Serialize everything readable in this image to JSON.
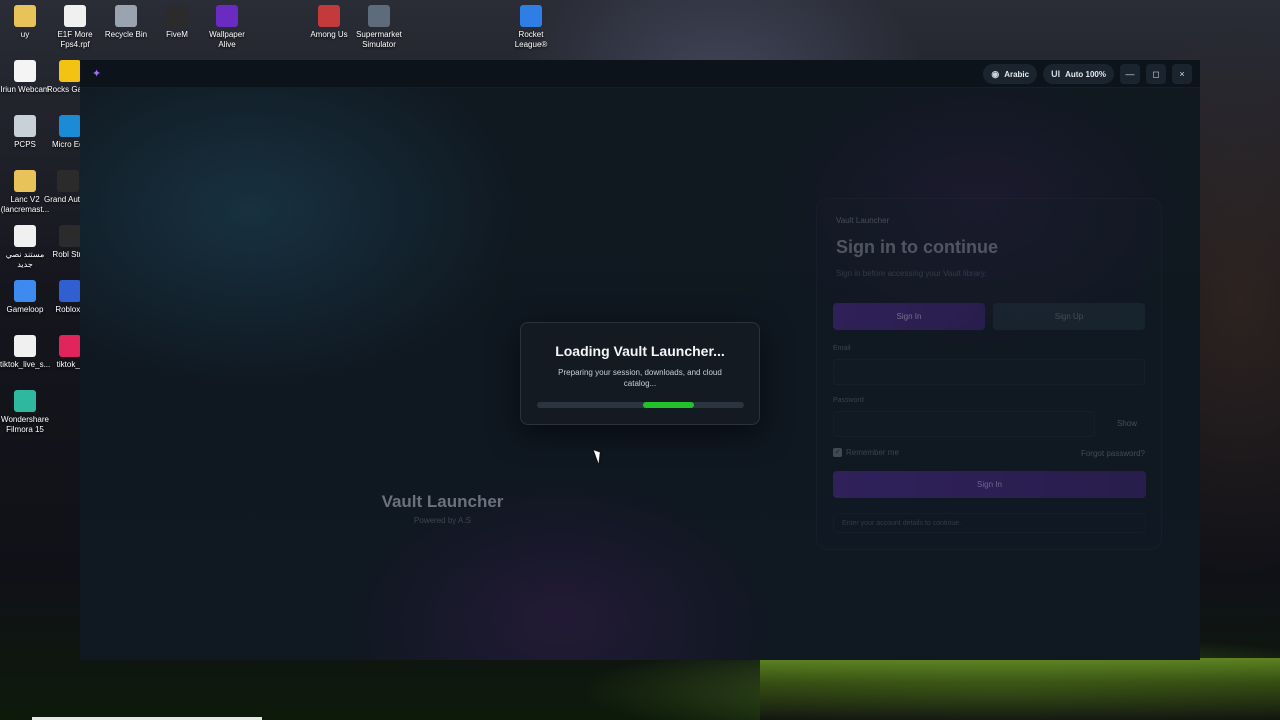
{
  "desktop": {
    "icons": [
      {
        "label": "uy",
        "glyph": "folder-icon",
        "color": "#e8c35a"
      },
      {
        "label": "E1F More Fps4.rpf",
        "glyph": "file-icon",
        "color": "#f0f0f0"
      },
      {
        "label": "Recycle Bin",
        "glyph": "recycle-bin-icon",
        "color": "#9aa4b0"
      },
      {
        "label": "FiveM",
        "glyph": "fivem-icon",
        "color": "#2b2b2b"
      },
      {
        "label": "Wallpaper Alive",
        "glyph": "wallpaper-alive-icon",
        "color": "#6a2bc2"
      },
      {
        "label": "Among Us",
        "glyph": "among-us-icon",
        "color": "#c23a3a"
      },
      {
        "label": "Supermarket Simulator",
        "glyph": "supermarket-icon",
        "color": "#5d6b7a"
      },
      {
        "label": "Rocket League®",
        "glyph": "rocket-league-icon",
        "color": "#2f7ee6"
      },
      {
        "label": "Iriun Webcam",
        "glyph": "webcam-icon",
        "color": "#f4f4f4"
      },
      {
        "label": "Rocks Game",
        "glyph": "rockstar-icon",
        "color": "#f3c313"
      },
      {
        "label": "PCPS",
        "glyph": "pcps-icon",
        "color": "#c8d0d8"
      },
      {
        "label": "Micro Edg",
        "glyph": "edge-icon",
        "color": "#1b8bd6"
      },
      {
        "label": "Lanc V2 (lancremast...",
        "glyph": "folder-icon",
        "color": "#e8c35a"
      },
      {
        "label": "Grand Auto V",
        "glyph": "gta-icon",
        "color": "#2b2b2b"
      },
      {
        "label": "مستند نصي جديد",
        "glyph": "text-document-icon",
        "color": "#f0f0f0"
      },
      {
        "label": "Robl Stud",
        "glyph": "roblox-studio-icon",
        "color": "#2b2b2b"
      },
      {
        "label": "Gameloop",
        "glyph": "gameloop-icon",
        "color": "#3d8bf0"
      },
      {
        "label": "Roblox I",
        "glyph": "roblox-icon",
        "color": "#2f5fd0"
      },
      {
        "label": "tiktok_live_s...",
        "glyph": "file-icon",
        "color": "#f0f0f0"
      },
      {
        "label": "tiktok_li",
        "glyph": "tiktok-icon",
        "color": "#e1245a"
      },
      {
        "label": "Wondershare Filmora 15",
        "glyph": "filmora-icon",
        "color": "#2fb8a0"
      }
    ]
  },
  "titlebar": {
    "language_label": "Arabic",
    "ui_prefix": "UI",
    "ui_scale_label": "Auto 100%",
    "minimize_glyph": "—",
    "maximize_glyph": "◻",
    "close_glyph": "×"
  },
  "brand": {
    "title": "Vault Launcher",
    "subtitle": "Powered by A.S"
  },
  "signin": {
    "label": "Vault Launcher",
    "title": "Sign in to continue",
    "subtitle": "Sign in before accessing your Vault library.",
    "tab_signin": "Sign In",
    "tab_signup": "Sign Up",
    "email_label": "Email",
    "password_label": "Password",
    "show_label": "Show",
    "remember_label": "Remember me",
    "forgot_label": "Forgot password?",
    "submit_label": "Sign In",
    "hint": "Enter your account details to continue."
  },
  "loader": {
    "title": "Loading Vault Launcher...",
    "subtitle": "Preparing your session, downloads, and cloud catalog...",
    "progress_start": 0.51,
    "progress_end": 0.76,
    "color": "#22c22b"
  }
}
